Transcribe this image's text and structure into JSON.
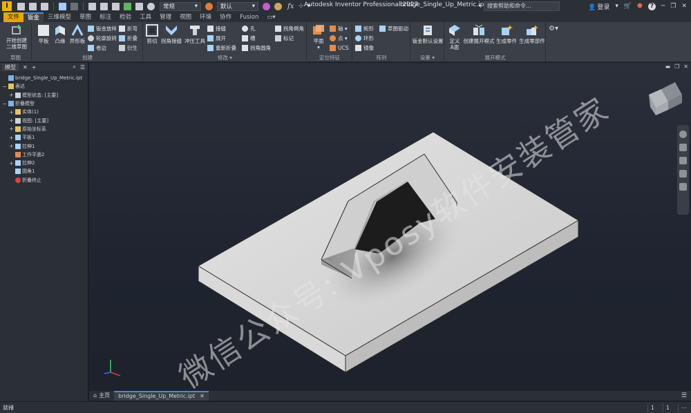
{
  "titlebar": {
    "logo_letter": "I",
    "style_select": "常规",
    "appearance_select": "默认",
    "fx_label": "fx",
    "app_title": "Autodesk Inventor Professional 2027",
    "file_name": "bridge_Single_Up_Metric.ipt",
    "search_placeholder": "搜索帮助和命令...",
    "login_label": "登录",
    "help_label": "?"
  },
  "tabs": [
    "文件",
    "钣金",
    "三维模型",
    "草图",
    "标注",
    "检验",
    "工具",
    "管理",
    "视图",
    "环境",
    "协作",
    "Fusion"
  ],
  "active_tab_index": 1,
  "ribbon": {
    "panels": {
      "sketch": "草图",
      "create": "创建",
      "modify": "修改 ▾",
      "locate": "定位特征",
      "pattern": "阵列",
      "setup": "设置 ▾",
      "flat": "展开模式"
    },
    "sketch_button": [
      "开始创建",
      "二维草图"
    ],
    "create_large": [
      "平板",
      "凸缘",
      "异形板"
    ],
    "create_small": [
      "钣金放样",
      "轮廓旋转",
      "卷边",
      "折弯",
      "折叠",
      "衍生"
    ],
    "modify_large": [
      "剪切",
      "拐角接缝",
      "冲压工具"
    ],
    "modify_small": [
      "接缝",
      "展开",
      "重新折叠",
      "孔",
      "槽",
      "拐角圆角",
      "拐角倒角",
      "标记"
    ],
    "locate_large": "平面",
    "locate_small": [
      "轴 ▾",
      "点 ▾",
      "UCS"
    ],
    "pattern_small": [
      "矩形",
      "环形",
      "镜像",
      "草图驱动"
    ],
    "setup_large": "钣金默认设置",
    "flat_large": [
      "定义\nA面",
      "创建展开模式",
      "生成零件",
      "生成零部件"
    ]
  },
  "browser": {
    "tab_label": "模型",
    "add_label": "+",
    "tree": [
      {
        "label": "bridge_Single_Up_Metric.ipt",
        "indent": 0,
        "exp": "",
        "icon": "part"
      },
      {
        "label": "表达",
        "indent": 0,
        "exp": "−",
        "icon": "folder"
      },
      {
        "label": "模型状态: [主要]",
        "indent": 1,
        "exp": "+",
        "icon": "state"
      },
      {
        "label": "折叠模型",
        "indent": 0,
        "exp": "−",
        "icon": "model"
      },
      {
        "label": "实体(1)",
        "indent": 1,
        "exp": "+",
        "icon": "folder"
      },
      {
        "label": "视图: [主要]",
        "indent": 1,
        "exp": "+",
        "icon": "eye"
      },
      {
        "label": "原始坐标系",
        "indent": 1,
        "exp": "+",
        "icon": "folder"
      },
      {
        "label": "平板1",
        "indent": 1,
        "exp": "+",
        "icon": "feature"
      },
      {
        "label": "拉伸1",
        "indent": 1,
        "exp": "+",
        "icon": "feature"
      },
      {
        "label": "工作平面2",
        "indent": 1,
        "exp": "",
        "icon": "plane"
      },
      {
        "label": "拉伸2",
        "indent": 1,
        "exp": "+",
        "icon": "feature"
      },
      {
        "label": "圆角1",
        "indent": 1,
        "exp": "",
        "icon": "feature"
      },
      {
        "label": "折叠终止",
        "indent": 1,
        "exp": "",
        "icon": "end"
      }
    ]
  },
  "doctabs": {
    "home_label": "主页",
    "file_label": "bridge_Single_Up_Metric.ipt"
  },
  "statusbar": {
    "status": "就绪",
    "count1": "1",
    "count2": "1"
  },
  "watermark": "微信公众号: Vposy软件安装管家",
  "colors": {
    "accent": "#3d8ee6",
    "file_tab": "#e8a800",
    "ribbon_bg": "#3b4048",
    "viewport_bg": "#1f2430"
  }
}
